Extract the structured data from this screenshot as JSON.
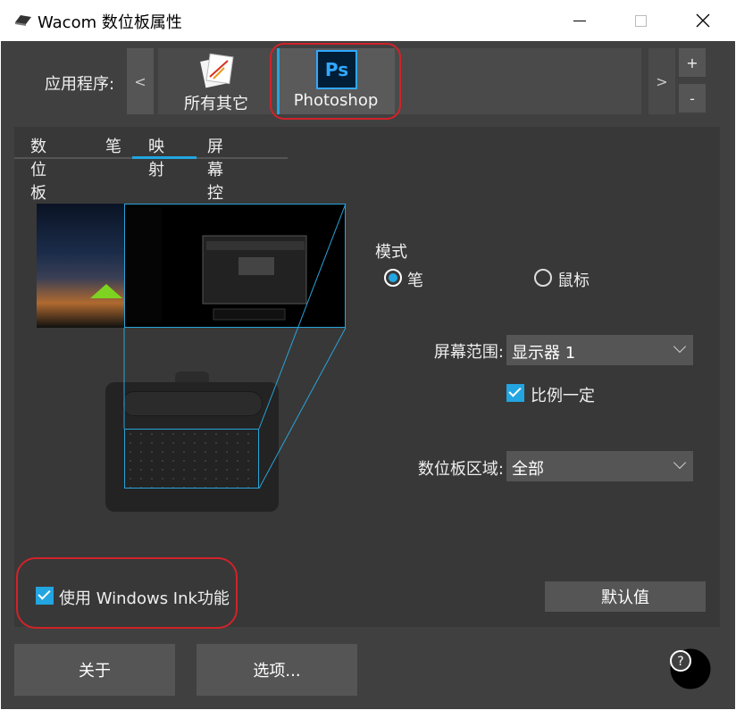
{
  "window": {
    "title": "Wacom 数位板属性"
  },
  "apps": {
    "label": "应用程序:",
    "prev_label": "<",
    "next_label": ">",
    "plus_label": "+",
    "minus_label": "-",
    "items": [
      {
        "label": "所有其它"
      },
      {
        "label": "Photoshop",
        "icon_text": "Ps"
      }
    ]
  },
  "tabs": [
    {
      "label": "数位板"
    },
    {
      "label": "笔"
    },
    {
      "label": "映射"
    },
    {
      "label": "屏幕控制"
    }
  ],
  "mapping": {
    "mode_label": "模式",
    "mode_pen": "笔",
    "mode_mouse": "鼠标",
    "screen_area_label": "屏幕范围:",
    "screen_area_value": "显示器 1",
    "force_proportions_label": "比例一定",
    "tablet_area_label": "数位板区域:",
    "tablet_area_value": "全部",
    "windows_ink_label": "使用 Windows Ink功能",
    "default_button": "默认值"
  },
  "footer": {
    "about_button": "关于",
    "options_button": "选项...",
    "help_icon": "?"
  },
  "colors": {
    "accent": "#22a5e0",
    "highlight": "#d0232a",
    "ps_blue": "#31a8ff"
  }
}
